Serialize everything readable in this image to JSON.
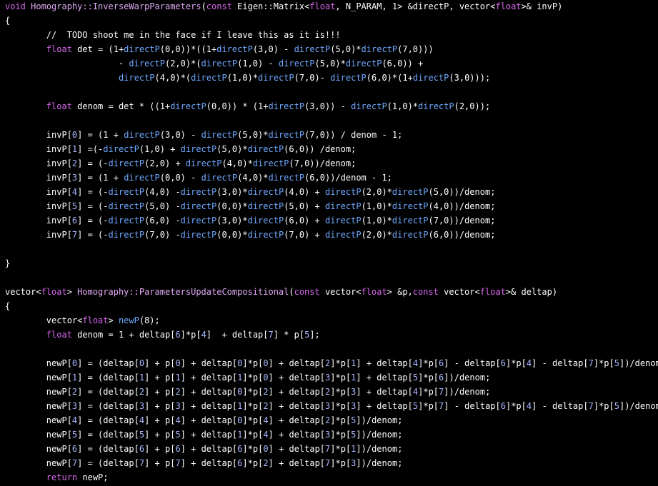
{
  "editor": {
    "background_color": "#000000",
    "colors": {
      "text": "#ffffff",
      "keyword": "#d966ee",
      "function": "#e0a8f5",
      "call": "#6fa8ff",
      "number": "#a9b8ff",
      "comment": "#ffffff"
    },
    "lines": [
      [
        [
          "kw",
          "void"
        ],
        [
          "txt",
          " "
        ],
        [
          "fn",
          "Homography::InverseWarpParameters"
        ],
        [
          "txt",
          "("
        ],
        [
          "kw",
          "const"
        ],
        [
          "txt",
          " Eigen::Matrix<"
        ],
        [
          "kw",
          "float"
        ],
        [
          "txt",
          ", N_PARAM, 1> &directP, vector<"
        ],
        [
          "kw",
          "float"
        ],
        [
          "txt",
          ">& invP)"
        ]
      ],
      [
        [
          "txt",
          "{"
        ]
      ],
      [
        [
          "cm",
          "        //  TODO shoot me in the face if I leave this as it is!!!"
        ]
      ],
      [
        [
          "txt",
          "        "
        ],
        [
          "kw",
          "float"
        ],
        [
          "txt",
          " det = (1+"
        ],
        [
          "call",
          "directP"
        ],
        [
          "txt",
          "(0,0))*((1+"
        ],
        [
          "call",
          "directP"
        ],
        [
          "txt",
          "(3,0) - "
        ],
        [
          "call",
          "directP"
        ],
        [
          "txt",
          "(5,0)*"
        ],
        [
          "call",
          "directP"
        ],
        [
          "txt",
          "(7,0)))"
        ]
      ],
      [
        [
          "txt",
          "                      - "
        ],
        [
          "call",
          "directP"
        ],
        [
          "txt",
          "(2,0)*("
        ],
        [
          "call",
          "directP"
        ],
        [
          "txt",
          "(1,0) - "
        ],
        [
          "call",
          "directP"
        ],
        [
          "txt",
          "(5,0)*"
        ],
        [
          "call",
          "directP"
        ],
        [
          "txt",
          "(6,0)) +"
        ]
      ],
      [
        [
          "txt",
          "                      "
        ],
        [
          "call",
          "directP"
        ],
        [
          "txt",
          "(4,0)*("
        ],
        [
          "call",
          "directP"
        ],
        [
          "txt",
          "(1,0)*"
        ],
        [
          "call",
          "directP"
        ],
        [
          "txt",
          "(7,0)- "
        ],
        [
          "call",
          "directP"
        ],
        [
          "txt",
          "(6,0)*(1+"
        ],
        [
          "call",
          "directP"
        ],
        [
          "txt",
          "(3,0)));"
        ]
      ],
      [],
      [
        [
          "txt",
          "        "
        ],
        [
          "kw",
          "float"
        ],
        [
          "txt",
          " denom = det * ((1+"
        ],
        [
          "call",
          "directP"
        ],
        [
          "txt",
          "(0,0)) * (1+"
        ],
        [
          "call",
          "directP"
        ],
        [
          "txt",
          "(3,0)) - "
        ],
        [
          "call",
          "directP"
        ],
        [
          "txt",
          "(1,0)*"
        ],
        [
          "call",
          "directP"
        ],
        [
          "txt",
          "(2,0));"
        ]
      ],
      [],
      [
        [
          "txt",
          "        invP["
        ],
        [
          "num",
          "0"
        ],
        [
          "txt",
          "] = (1 + "
        ],
        [
          "call",
          "directP"
        ],
        [
          "txt",
          "(3,0) - "
        ],
        [
          "call",
          "directP"
        ],
        [
          "txt",
          "(5,0)*"
        ],
        [
          "call",
          "directP"
        ],
        [
          "txt",
          "(7,0)) / denom - 1;"
        ]
      ],
      [
        [
          "txt",
          "        invP["
        ],
        [
          "num",
          "1"
        ],
        [
          "txt",
          "] =(-"
        ],
        [
          "call",
          "directP"
        ],
        [
          "txt",
          "(1,0) + "
        ],
        [
          "call",
          "directP"
        ],
        [
          "txt",
          "(5,0)*"
        ],
        [
          "call",
          "directP"
        ],
        [
          "txt",
          "(6,0)) /denom;"
        ]
      ],
      [
        [
          "txt",
          "        invP["
        ],
        [
          "num",
          "2"
        ],
        [
          "txt",
          "] = (-"
        ],
        [
          "call",
          "directP"
        ],
        [
          "txt",
          "(2,0) + "
        ],
        [
          "call",
          "directP"
        ],
        [
          "txt",
          "(4,0)*"
        ],
        [
          "call",
          "directP"
        ],
        [
          "txt",
          "(7,0))/denom;"
        ]
      ],
      [
        [
          "txt",
          "        invP["
        ],
        [
          "num",
          "3"
        ],
        [
          "txt",
          "] = (1 + "
        ],
        [
          "call",
          "directP"
        ],
        [
          "txt",
          "(0,0) - "
        ],
        [
          "call",
          "directP"
        ],
        [
          "txt",
          "(4,0)*"
        ],
        [
          "call",
          "directP"
        ],
        [
          "txt",
          "(6,0))/denom - 1;"
        ]
      ],
      [
        [
          "txt",
          "        invP["
        ],
        [
          "num",
          "4"
        ],
        [
          "txt",
          "] = (-"
        ],
        [
          "call",
          "directP"
        ],
        [
          "txt",
          "(4,0) -"
        ],
        [
          "call",
          "directP"
        ],
        [
          "txt",
          "(3,0)*"
        ],
        [
          "call",
          "directP"
        ],
        [
          "txt",
          "(4,0) + "
        ],
        [
          "call",
          "directP"
        ],
        [
          "txt",
          "(2,0)*"
        ],
        [
          "call",
          "directP"
        ],
        [
          "txt",
          "(5,0))/denom;"
        ]
      ],
      [
        [
          "txt",
          "        invP["
        ],
        [
          "num",
          "5"
        ],
        [
          "txt",
          "] = (-"
        ],
        [
          "call",
          "directP"
        ],
        [
          "txt",
          "(5,0) -"
        ],
        [
          "call",
          "directP"
        ],
        [
          "txt",
          "(0,0)*"
        ],
        [
          "call",
          "directP"
        ],
        [
          "txt",
          "(5,0) + "
        ],
        [
          "call",
          "directP"
        ],
        [
          "txt",
          "(1,0)*"
        ],
        [
          "call",
          "directP"
        ],
        [
          "txt",
          "(4,0))/denom;"
        ]
      ],
      [
        [
          "txt",
          "        invP["
        ],
        [
          "num",
          "6"
        ],
        [
          "txt",
          "] = (-"
        ],
        [
          "call",
          "directP"
        ],
        [
          "txt",
          "(6,0) -"
        ],
        [
          "call",
          "directP"
        ],
        [
          "txt",
          "(3,0)*"
        ],
        [
          "call",
          "directP"
        ],
        [
          "txt",
          "(6,0) + "
        ],
        [
          "call",
          "directP"
        ],
        [
          "txt",
          "(1,0)*"
        ],
        [
          "call",
          "directP"
        ],
        [
          "txt",
          "(7,0))/denom;"
        ]
      ],
      [
        [
          "txt",
          "        invP["
        ],
        [
          "num",
          "7"
        ],
        [
          "txt",
          "] = (-"
        ],
        [
          "call",
          "directP"
        ],
        [
          "txt",
          "(7,0) -"
        ],
        [
          "call",
          "directP"
        ],
        [
          "txt",
          "(0,0)*"
        ],
        [
          "call",
          "directP"
        ],
        [
          "txt",
          "(7,0) + "
        ],
        [
          "call",
          "directP"
        ],
        [
          "txt",
          "(2,0)*"
        ],
        [
          "call",
          "directP"
        ],
        [
          "txt",
          "(6,0))/denom;"
        ]
      ],
      [],
      [
        [
          "txt",
          "}"
        ]
      ],
      [],
      [
        [
          "txt",
          "vector<"
        ],
        [
          "kw",
          "float"
        ],
        [
          "txt",
          "> "
        ],
        [
          "fn",
          "Homography::ParametersUpdateCompositional"
        ],
        [
          "txt",
          "("
        ],
        [
          "kw",
          "const"
        ],
        [
          "txt",
          " vector<"
        ],
        [
          "kw",
          "float"
        ],
        [
          "txt",
          "> &p,"
        ],
        [
          "kw",
          "const"
        ],
        [
          "txt",
          " vector<"
        ],
        [
          "kw",
          "float"
        ],
        [
          "txt",
          ">& deltap)"
        ]
      ],
      [
        [
          "txt",
          "{"
        ]
      ],
      [
        [
          "txt",
          "        vector<"
        ],
        [
          "kw",
          "float"
        ],
        [
          "txt",
          "> "
        ],
        [
          "call",
          "newP"
        ],
        [
          "txt",
          "(8);"
        ]
      ],
      [
        [
          "txt",
          "        "
        ],
        [
          "kw",
          "float"
        ],
        [
          "txt",
          " denom = 1 + deltap["
        ],
        [
          "num",
          "6"
        ],
        [
          "txt",
          "]*p["
        ],
        [
          "num",
          "4"
        ],
        [
          "txt",
          "]  + deltap["
        ],
        [
          "num",
          "7"
        ],
        [
          "txt",
          "] * p["
        ],
        [
          "num",
          "5"
        ],
        [
          "txt",
          "];"
        ]
      ],
      [],
      [
        [
          "txt",
          "        newP["
        ],
        [
          "num",
          "0"
        ],
        [
          "txt",
          "] = (deltap["
        ],
        [
          "num",
          "0"
        ],
        [
          "txt",
          "] + p["
        ],
        [
          "num",
          "0"
        ],
        [
          "txt",
          "] + deltap["
        ],
        [
          "num",
          "0"
        ],
        [
          "txt",
          "]*p["
        ],
        [
          "num",
          "0"
        ],
        [
          "txt",
          "] + deltap["
        ],
        [
          "num",
          "2"
        ],
        [
          "txt",
          "]*p["
        ],
        [
          "num",
          "1"
        ],
        [
          "txt",
          "] + deltap["
        ],
        [
          "num",
          "4"
        ],
        [
          "txt",
          "]*p["
        ],
        [
          "num",
          "6"
        ],
        [
          "txt",
          "] - deltap["
        ],
        [
          "num",
          "6"
        ],
        [
          "txt",
          "]*p["
        ],
        [
          "num",
          "4"
        ],
        [
          "txt",
          "] - deltap["
        ],
        [
          "num",
          "7"
        ],
        [
          "txt",
          "]*p["
        ],
        [
          "num",
          "5"
        ],
        [
          "txt",
          "])/denom"
        ]
      ],
      [
        [
          "txt",
          "        newP["
        ],
        [
          "num",
          "1"
        ],
        [
          "txt",
          "] = (deltap["
        ],
        [
          "num",
          "1"
        ],
        [
          "txt",
          "] + p["
        ],
        [
          "num",
          "1"
        ],
        [
          "txt",
          "] + deltap["
        ],
        [
          "num",
          "1"
        ],
        [
          "txt",
          "]*p["
        ],
        [
          "num",
          "0"
        ],
        [
          "txt",
          "] + deltap["
        ],
        [
          "num",
          "3"
        ],
        [
          "txt",
          "]*p["
        ],
        [
          "num",
          "1"
        ],
        [
          "txt",
          "] + deltap["
        ],
        [
          "num",
          "5"
        ],
        [
          "txt",
          "]*p["
        ],
        [
          "num",
          "6"
        ],
        [
          "txt",
          "])/denom;"
        ]
      ],
      [
        [
          "txt",
          "        newP["
        ],
        [
          "num",
          "2"
        ],
        [
          "txt",
          "] = (deltap["
        ],
        [
          "num",
          "2"
        ],
        [
          "txt",
          "] + p["
        ],
        [
          "num",
          "2"
        ],
        [
          "txt",
          "] + deltap["
        ],
        [
          "num",
          "0"
        ],
        [
          "txt",
          "]*p["
        ],
        [
          "num",
          "2"
        ],
        [
          "txt",
          "] + deltap["
        ],
        [
          "num",
          "2"
        ],
        [
          "txt",
          "]*p["
        ],
        [
          "num",
          "3"
        ],
        [
          "txt",
          "] + deltap["
        ],
        [
          "num",
          "4"
        ],
        [
          "txt",
          "]*p["
        ],
        [
          "num",
          "7"
        ],
        [
          "txt",
          "])/denom;"
        ]
      ],
      [
        [
          "txt",
          "        newP["
        ],
        [
          "num",
          "3"
        ],
        [
          "txt",
          "] = (deltap["
        ],
        [
          "num",
          "3"
        ],
        [
          "txt",
          "] + p["
        ],
        [
          "num",
          "3"
        ],
        [
          "txt",
          "] + deltap["
        ],
        [
          "num",
          "1"
        ],
        [
          "txt",
          "]*p["
        ],
        [
          "num",
          "2"
        ],
        [
          "txt",
          "] + deltap["
        ],
        [
          "num",
          "3"
        ],
        [
          "txt",
          "]*p["
        ],
        [
          "num",
          "3"
        ],
        [
          "txt",
          "] + deltap["
        ],
        [
          "num",
          "5"
        ],
        [
          "txt",
          "]*p["
        ],
        [
          "num",
          "7"
        ],
        [
          "txt",
          "] - deltap["
        ],
        [
          "num",
          "6"
        ],
        [
          "txt",
          "]*p["
        ],
        [
          "num",
          "4"
        ],
        [
          "txt",
          "] - deltap["
        ],
        [
          "num",
          "7"
        ],
        [
          "txt",
          "]*p["
        ],
        [
          "num",
          "5"
        ],
        [
          "txt",
          "])/denom"
        ]
      ],
      [
        [
          "txt",
          "        newP["
        ],
        [
          "num",
          "4"
        ],
        [
          "txt",
          "] = (deltap["
        ],
        [
          "num",
          "4"
        ],
        [
          "txt",
          "] + p["
        ],
        [
          "num",
          "4"
        ],
        [
          "txt",
          "] + deltap["
        ],
        [
          "num",
          "0"
        ],
        [
          "txt",
          "]*p["
        ],
        [
          "num",
          "4"
        ],
        [
          "txt",
          "] + deltap["
        ],
        [
          "num",
          "2"
        ],
        [
          "txt",
          "]*p["
        ],
        [
          "num",
          "5"
        ],
        [
          "txt",
          "])/denom;"
        ]
      ],
      [
        [
          "txt",
          "        newP["
        ],
        [
          "num",
          "5"
        ],
        [
          "txt",
          "] = (deltap["
        ],
        [
          "num",
          "5"
        ],
        [
          "txt",
          "] + p["
        ],
        [
          "num",
          "5"
        ],
        [
          "txt",
          "] + deltap["
        ],
        [
          "num",
          "1"
        ],
        [
          "txt",
          "]*p["
        ],
        [
          "num",
          "4"
        ],
        [
          "txt",
          "] + deltap["
        ],
        [
          "num",
          "3"
        ],
        [
          "txt",
          "]*p["
        ],
        [
          "num",
          "5"
        ],
        [
          "txt",
          "])/denom;"
        ]
      ],
      [
        [
          "txt",
          "        newP["
        ],
        [
          "num",
          "6"
        ],
        [
          "txt",
          "] = (deltap["
        ],
        [
          "num",
          "6"
        ],
        [
          "txt",
          "] + p["
        ],
        [
          "num",
          "6"
        ],
        [
          "txt",
          "] + deltap["
        ],
        [
          "num",
          "6"
        ],
        [
          "txt",
          "]*p["
        ],
        [
          "num",
          "0"
        ],
        [
          "txt",
          "] + deltap["
        ],
        [
          "num",
          "7"
        ],
        [
          "txt",
          "]*p["
        ],
        [
          "num",
          "1"
        ],
        [
          "txt",
          "])/denom;"
        ]
      ],
      [
        [
          "txt",
          "        newP["
        ],
        [
          "num",
          "7"
        ],
        [
          "txt",
          "] = (deltap["
        ],
        [
          "num",
          "7"
        ],
        [
          "txt",
          "] + p["
        ],
        [
          "num",
          "7"
        ],
        [
          "txt",
          "] + deltap["
        ],
        [
          "num",
          "6"
        ],
        [
          "txt",
          "]*p["
        ],
        [
          "num",
          "2"
        ],
        [
          "txt",
          "] + deltap["
        ],
        [
          "num",
          "7"
        ],
        [
          "txt",
          "]*p["
        ],
        [
          "num",
          "3"
        ],
        [
          "txt",
          "])/denom;"
        ]
      ],
      [
        [
          "txt",
          "        "
        ],
        [
          "kw",
          "return"
        ],
        [
          "txt",
          " newP;"
        ]
      ]
    ]
  }
}
